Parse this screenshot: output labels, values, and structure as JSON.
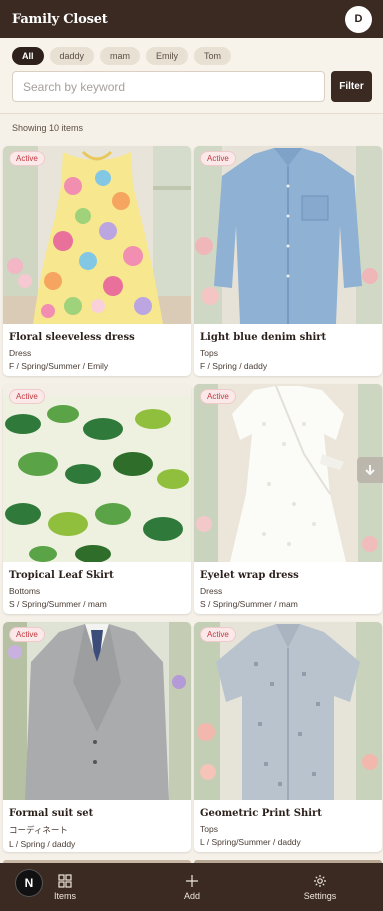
{
  "header": {
    "title": "Family Closet",
    "avatar_initial": "D"
  },
  "filters": {
    "chips": [
      {
        "label": "All",
        "active": true
      },
      {
        "label": "daddy",
        "active": false
      },
      {
        "label": "mam",
        "active": false
      },
      {
        "label": "Emily",
        "active": false
      },
      {
        "label": "Tom",
        "active": false
      }
    ],
    "search_placeholder": "Search by keyword",
    "filter_label": "Filter"
  },
  "results": {
    "count_text": "Showing 10 items"
  },
  "items": [
    {
      "status": "Active",
      "name": "Floral sleeveless dress",
      "category": "Dress",
      "meta": "F / Spring/Summer / Emily"
    },
    {
      "status": "Active",
      "name": "Light blue denim shirt",
      "category": "Tops",
      "meta": "F / Spring / daddy"
    },
    {
      "status": "Active",
      "name": "Tropical Leaf Skirt",
      "category": "Bottoms",
      "meta": "S / Spring/Summer / mam"
    },
    {
      "status": "Active",
      "name": "Eyelet wrap dress",
      "category": "Dress",
      "meta": "S / Spring/Summer / mam"
    },
    {
      "status": "Active",
      "name": "Formal suit set",
      "category": "コーディネート",
      "meta": "L / Spring / daddy"
    },
    {
      "status": "Active",
      "name": "Geometric Print Shirt",
      "category": "Tops",
      "meta": "L / Spring/Summer / daddy"
    }
  ],
  "bottom_nav": {
    "items": [
      {
        "label": "Items",
        "icon": "grid-icon"
      },
      {
        "label": "Add",
        "icon": "plus-icon"
      },
      {
        "label": "Settings",
        "icon": "gear-icon"
      }
    ],
    "badge": "N"
  }
}
